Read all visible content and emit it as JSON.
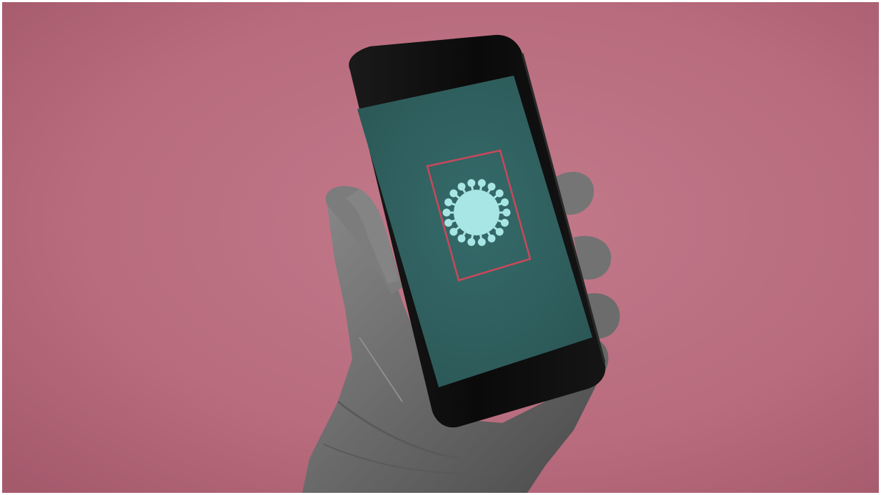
{
  "image": {
    "subject": "gloved-hand-holding-smartphone",
    "screen_icon": "virus-icon",
    "colors": {
      "background": "#b86c7e",
      "background_edge": "#a55a6c",
      "background_center": "#c27a8a",
      "glove": "#6e6e6e",
      "phone_body": "#0d0d0d",
      "screen": "#2f5f5e",
      "screen_frame": "#c9485a",
      "virus": "#a7e6e4"
    }
  }
}
